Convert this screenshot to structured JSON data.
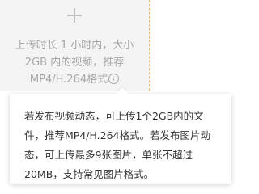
{
  "upload": {
    "hint_text": "上传时长 1 小时内，大小 2GB 内的视频，推荐MP4/H.264格式",
    "add_icon": "plus-icon",
    "info_icon": "info-circle-icon"
  },
  "tooltip": {
    "text": "若发布视频动态，可上传1个2GB内的文件，推荐MP4/H.264格式。若发布图片动态，可上传最多9张图片，单张不超过20MB，支持常见图片格式。"
  },
  "colors": {
    "upload_background": "#f4f4f5",
    "hint_text": "#a6a6a6",
    "tooltip_text": "#333333",
    "dashed_divider": "#f2b66b"
  }
}
